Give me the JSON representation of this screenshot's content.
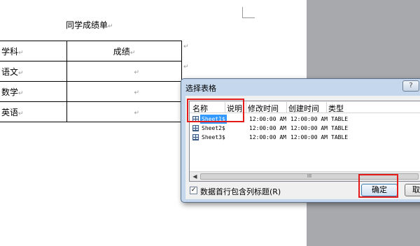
{
  "document": {
    "title": "同学成绩单",
    "paragraph_mark": "↵",
    "table": {
      "headers": [
        "学科",
        "成绩"
      ],
      "rows": [
        [
          "语文",
          ""
        ],
        [
          "数学",
          ""
        ],
        [
          "英语",
          ""
        ]
      ]
    }
  },
  "dialog": {
    "title": "选择表格",
    "help_label": "?",
    "columns": {
      "name": "名称",
      "description": "说明",
      "modified": "修改时间",
      "created": "创建时间",
      "type": "类型"
    },
    "rows": [
      {
        "name": "Sheet1$",
        "description": "",
        "modified": "12:00:00 AM",
        "created": "12:00:00 AM",
        "type": "TABLE",
        "selected": true
      },
      {
        "name": "Sheet2$",
        "description": "",
        "modified": "12:00:00 AM",
        "created": "12:00:00 AM",
        "type": "TABLE",
        "selected": false
      },
      {
        "name": "Sheet3$",
        "description": "",
        "modified": "12:00:00 AM",
        "created": "12:00:00 AM",
        "type": "TABLE",
        "selected": false
      }
    ],
    "scroll_left": "◀",
    "scroll_grip": "III",
    "checkbox": {
      "label": "数据首行包含列标题(R)",
      "checked": true,
      "check_mark": "✓"
    },
    "ok_label": "确定",
    "cancel_label": "取消"
  },
  "colors": {
    "dialog_frame": "#c4d7ed",
    "selection": "#3399ff",
    "annotation": "#e51b1b"
  }
}
